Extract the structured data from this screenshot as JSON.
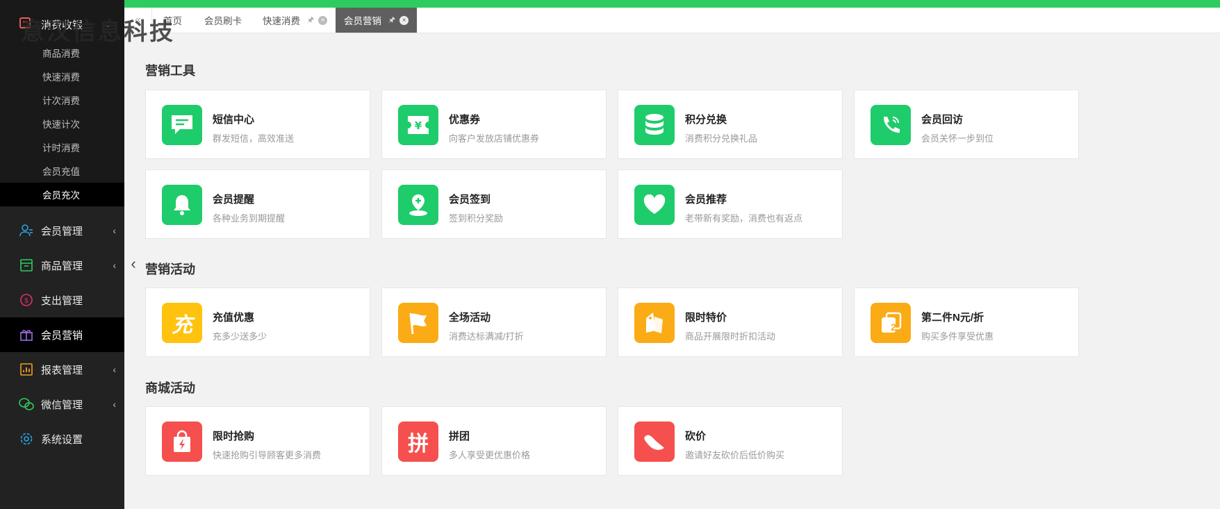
{
  "watermark": "意汉信息科技",
  "sidebar": {
    "head_label": "消费收银",
    "sub_items": [
      "商品消费",
      "快速消费",
      "计次消费",
      "快速计次",
      "计时消费",
      "会员充值",
      "会员充次"
    ],
    "items": [
      {
        "label": "会员管理",
        "icon": "user-icon",
        "arrow": "‹"
      },
      {
        "label": "商品管理",
        "icon": "product-icon",
        "arrow": "‹"
      },
      {
        "label": "支出管理",
        "icon": "expense-icon",
        "arrow": ""
      },
      {
        "label": "会员营销",
        "icon": "gift-icon",
        "arrow": ""
      },
      {
        "label": "报表管理",
        "icon": "chart-icon",
        "arrow": "‹"
      },
      {
        "label": "微信管理",
        "icon": "wechat-icon",
        "arrow": "‹"
      },
      {
        "label": "系统设置",
        "icon": "gear-icon",
        "arrow": ""
      }
    ]
  },
  "tabs": [
    {
      "label": "首页"
    },
    {
      "label": "会员刷卡"
    },
    {
      "label": "快速消费"
    },
    {
      "label": "会员营销"
    }
  ],
  "sections": [
    {
      "title": "营销工具",
      "cards": [
        {
          "title": "短信中心",
          "desc": "群发短信，高效准送",
          "icon": "message-icon",
          "color": "#1fcc6b"
        },
        {
          "title": "优惠券",
          "desc": "向客户发放店铺优惠券",
          "icon": "coupon-icon",
          "color": "#1fcc6b"
        },
        {
          "title": "积分兑换",
          "desc": "消费积分兑换礼品",
          "icon": "database-icon",
          "color": "#1fcc6b"
        },
        {
          "title": "会员回访",
          "desc": "会员关怀一步到位",
          "icon": "phone-icon",
          "color": "#1fcc6b"
        },
        {
          "title": "会员提醒",
          "desc": "各种业务到期提醒",
          "icon": "bell-icon",
          "color": "#1fcc6b"
        },
        {
          "title": "会员签到",
          "desc": "签到积分奖励",
          "icon": "location-icon",
          "color": "#1fcc6b"
        },
        {
          "title": "会员推荐",
          "desc": "老带新有奖励，消费也有返点",
          "icon": "heart-icon",
          "color": "#1fcc6b"
        }
      ]
    },
    {
      "title": "营销活动",
      "cards": [
        {
          "title": "充值优惠",
          "desc": "充多少送多少",
          "icon": "recharge-icon",
          "glyph": "充",
          "color": "#ffc20e"
        },
        {
          "title": "全场活动",
          "desc": "消费达标满减/打折",
          "icon": "flag-icon",
          "color": "#fbab15"
        },
        {
          "title": "限时特价",
          "desc": "商品开展限时折扣活动",
          "icon": "tag-icon",
          "color": "#fbab15"
        },
        {
          "title": "第二件N元/折",
          "desc": "购买多件享受优惠",
          "icon": "second-item-icon",
          "glyph": "2",
          "color": "#fbab15"
        }
      ]
    },
    {
      "title": "商城活动",
      "cards": [
        {
          "title": "限时抢购",
          "desc": "快速抢购引导顾客更多消费",
          "icon": "flash-bag-icon",
          "color": "#f5504d"
        },
        {
          "title": "拼团",
          "desc": "多人享受更优惠价格",
          "icon": "group-buy-icon",
          "glyph": "拼",
          "color": "#f5504d"
        },
        {
          "title": "砍价",
          "desc": "邀请好友砍价后低价购买",
          "icon": "bargain-icon",
          "color": "#f5504d"
        }
      ]
    }
  ]
}
